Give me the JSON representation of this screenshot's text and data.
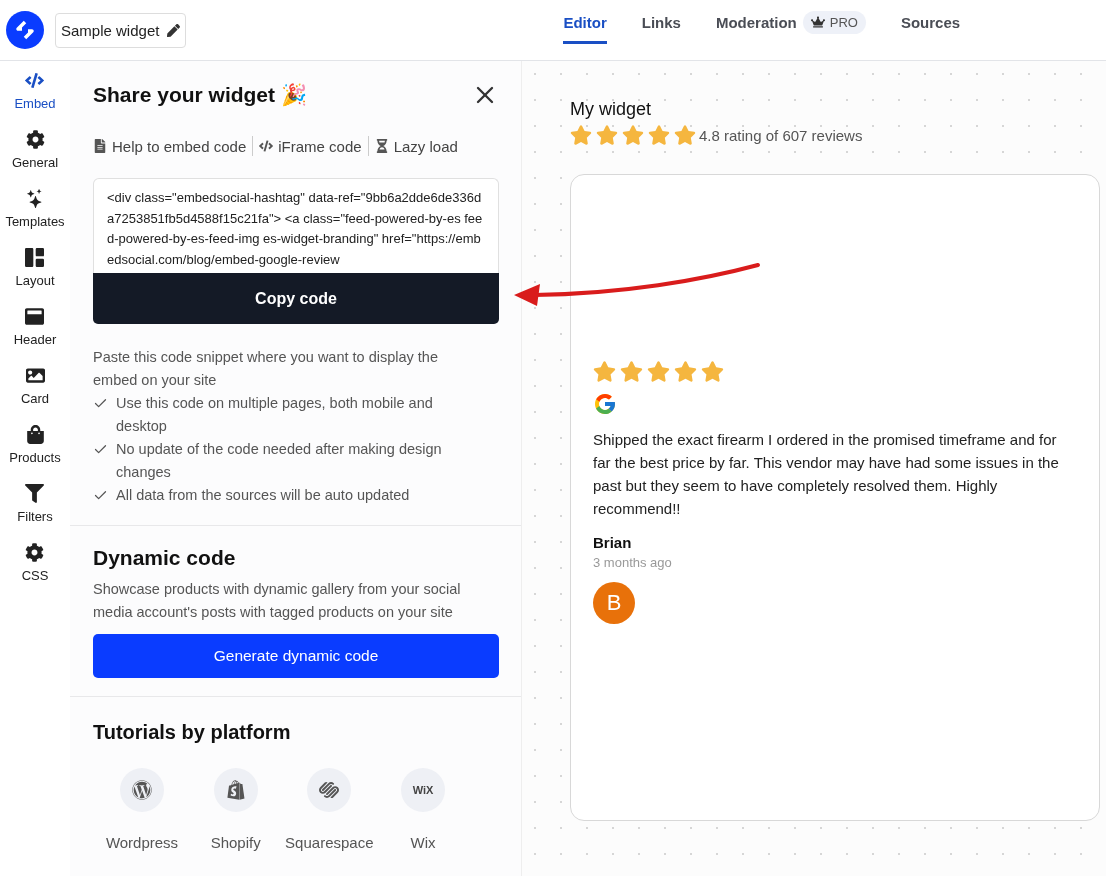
{
  "header": {
    "widget_name": "Sample widget"
  },
  "tabs": [
    {
      "label": "Editor",
      "selected": true
    },
    {
      "label": "Links",
      "selected": false
    },
    {
      "label": "Moderation",
      "selected": false,
      "badge": "PRO"
    },
    {
      "label": "Sources",
      "selected": false
    }
  ],
  "sidebar": {
    "items": [
      {
        "label": "Embed",
        "selected": true
      },
      {
        "label": "General",
        "selected": false
      },
      {
        "label": "Templates",
        "selected": false
      },
      {
        "label": "Layout",
        "selected": false
      },
      {
        "label": "Header",
        "selected": false
      },
      {
        "label": "Card",
        "selected": false
      },
      {
        "label": "Products",
        "selected": false
      },
      {
        "label": "Filters",
        "selected": false
      },
      {
        "label": "CSS",
        "selected": false
      }
    ]
  },
  "panel": {
    "title": "Share your widget",
    "title_emoji": "🎉",
    "links": [
      "Help to embed code",
      "iFrame code",
      "Lazy load"
    ],
    "code": "<div class=\"embedsocial-hashtag\" data-ref=\"9bb6a2dde6de336da7253851fb5d4588f15c21fa\"> <a class=\"feed-powered-by-es feed-powered-by-es-feed-img es-widget-branding\" href=\"https://embedsocial.com/blog/embed-google-review",
    "copy_button": "Copy code",
    "description": "Paste this code snippet where you want to display the embed on your site",
    "checklist": [
      "Use this code on multiple pages, both mobile and desktop",
      "No update of the code needed after making design changes",
      "All data from the sources will be auto updated"
    ],
    "dynamic": {
      "title": "Dynamic code",
      "description": "Showcase products with dynamic gallery from your social media account's posts with tagged products on your site",
      "button": "Generate dynamic code"
    },
    "tutorials": {
      "title": "Tutorials by platform",
      "platforms": [
        {
          "label": "Wordpress"
        },
        {
          "label": "Shopify"
        },
        {
          "label": "Squarespace"
        },
        {
          "label": "Wix",
          "icon_text": "WiX"
        }
      ]
    }
  },
  "preview": {
    "title": "My widget",
    "stars": 5,
    "rating": "4.8 rating of 607 reviews",
    "review": {
      "stars": 5,
      "text": "Shipped the exact firearm I ordered in the promised timeframe and for far the best price by far. This vendor may have had some issues in the past but they seem to have completely resolved them. Highly recommend!!",
      "author": "Brian",
      "time": "3 months ago",
      "avatar": "B",
      "color": "#e8710a"
    }
  }
}
